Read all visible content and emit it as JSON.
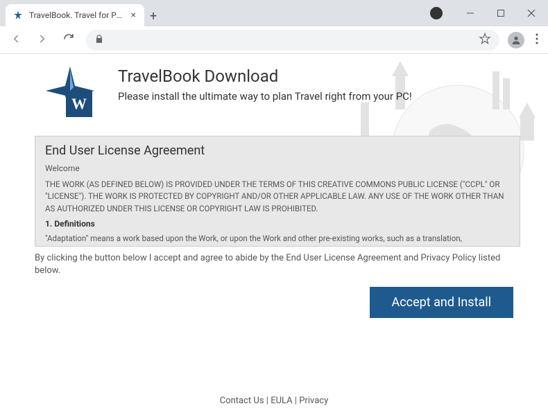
{
  "window": {
    "tab_title": "TravelBook. Travel for PC."
  },
  "header": {
    "title": "TravelBook Download",
    "subtitle": "Please install the ultimate way to plan Travel right from your PC!",
    "logo_letter": "W"
  },
  "eula": {
    "title": "End User License Agreement",
    "welcome": "Welcome",
    "paragraph1": "THE WORK (AS DEFINED BELOW) IS PROVIDED UNDER THE TERMS OF THIS CREATIVE COMMONS PUBLIC LICENSE (\"CCPL\" OR \"LICENSE\"). THE WORK IS PROTECTED BY COPYRIGHT AND/OR OTHER APPLICABLE LAW. ANY USE OF THE WORK OTHER THAN AS AUTHORIZED UNDER THIS LICENSE OR COPYRIGHT LAW IS PROHIBITED.",
    "heading1": "1. Definitions",
    "paragraph2": "\"Adaptation\" means a work based upon the Work, or upon the Work and other pre-existing works, such as a translation,"
  },
  "consent": "By clicking the button below I accept and agree to abide by the End User License Agreement and Privacy Policy listed below.",
  "install_button": "Accept and Install",
  "footer": {
    "contact": "Contact Us",
    "eula": "EULA",
    "privacy": "Privacy",
    "sep": " | "
  }
}
